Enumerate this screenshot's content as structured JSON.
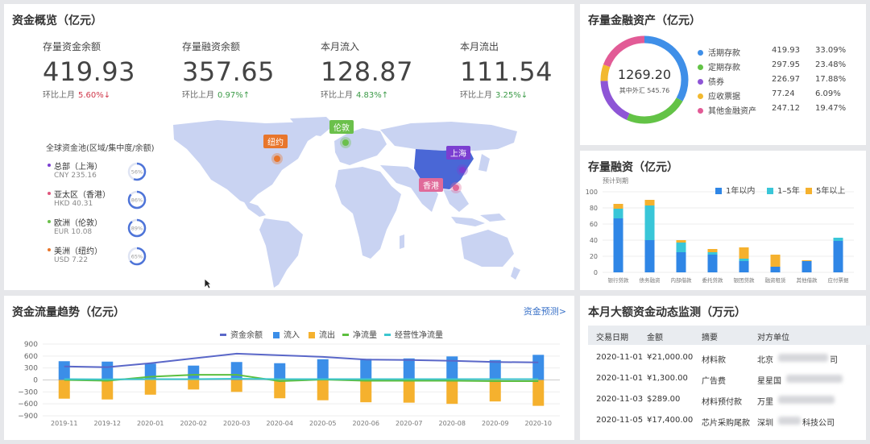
{
  "overview": {
    "title": "资金概览（亿元）",
    "kpis": [
      {
        "label": "存量资金余额",
        "value": "419.93",
        "compare": "环比上月",
        "pct": "5.60%",
        "arrow": "↓",
        "trend": "down"
      },
      {
        "label": "存量融资余额",
        "value": "357.65",
        "compare": "环比上月",
        "pct": "0.97%",
        "arrow": "↑",
        "trend": "up"
      },
      {
        "label": "本月流入",
        "value": "128.87",
        "compare": "环比上月",
        "pct": "4.83%",
        "arrow": "↑",
        "trend": "up"
      },
      {
        "label": "本月流出",
        "value": "111.54",
        "compare": "环比上月",
        "pct": "3.25%",
        "arrow": "↓",
        "trend": "down"
      }
    ],
    "pool_title": "全球资金池(区域/集中度/余额)",
    "pool": [
      {
        "name": "总部（上海）",
        "amount": "CNY 235.16",
        "pct": "56%",
        "color": "#7b3fd1"
      },
      {
        "name": "亚太区（香港）",
        "amount": "HKD 40.31",
        "pct": "86%",
        "color": "#e0557c"
      },
      {
        "name": "欧洲（伦敦）",
        "amount": "EUR 10.08",
        "pct": "89%",
        "color": "#6bc04b"
      },
      {
        "name": "美洲（纽约）",
        "amount": "USD 7.22",
        "pct": "65%",
        "color": "#e8762c"
      }
    ],
    "map_pins": [
      {
        "label": "纽约",
        "color": "#e8762c"
      },
      {
        "label": "伦敦",
        "color": "#6bc04b"
      },
      {
        "label": "上海",
        "color": "#7b3fd1"
      },
      {
        "label": "香港",
        "color": "#e06a9a"
      }
    ]
  },
  "assets": {
    "title": "存量金融资产（亿元）",
    "total": "1269.20",
    "sub": "其中外汇 545.76",
    "items": [
      {
        "name": "活期存款",
        "value": "419.93",
        "pct": "33.09%",
        "color": "#3f8fe8",
        "share": 33.09
      },
      {
        "name": "定期存款",
        "value": "297.95",
        "pct": "23.48%",
        "color": "#63c346",
        "share": 23.48
      },
      {
        "name": "债券",
        "value": "226.97",
        "pct": "17.88%",
        "color": "#8e55d6",
        "share": 17.88
      },
      {
        "name": "应收票据",
        "value": "77.24",
        "pct": "6.09%",
        "color": "#f2b92f",
        "share": 6.09
      },
      {
        "name": "其他金融资产",
        "value": "247.12",
        "pct": "19.47%",
        "color": "#e25b96",
        "share": 19.47
      }
    ]
  },
  "financing": {
    "title": "存量融资（亿元）",
    "chart_data": {
      "type": "bar",
      "stacked": true,
      "subtitle": "预计到期",
      "categories": [
        "银行贷款",
        "债务融资",
        "内部借款",
        "委托贷款",
        "银团贷款",
        "融资租赁",
        "其他借款",
        "应付票据"
      ],
      "ylim": [
        0,
        100
      ],
      "yticks": [
        "0",
        "20",
        "40",
        "60",
        "80",
        "100"
      ],
      "legend_position": "top-right",
      "series": [
        {
          "name": "1年以内",
          "color": "#2f86e6",
          "values": [
            67,
            40,
            25,
            22,
            14,
            7,
            14,
            39
          ]
        },
        {
          "name": "1–5年",
          "color": "#39c6d8",
          "values": [
            12,
            43,
            12,
            3,
            3,
            0,
            0,
            4
          ]
        },
        {
          "name": "5年以上",
          "color": "#f5b12e",
          "values": [
            6,
            7,
            3,
            4,
            14,
            15,
            1,
            0
          ]
        }
      ]
    }
  },
  "trend": {
    "title": "资金流量趋势（亿元）",
    "link": "资金预测>",
    "chart_data": {
      "type": "bar",
      "ylim": [
        -900,
        900
      ],
      "yticks": [
        "900",
        "600",
        "300",
        "0",
        "−300",
        "−600",
        "−900"
      ],
      "categories": [
        "2019-11",
        "2019-12",
        "2020-01",
        "2020-02",
        "2020-03",
        "2020-04",
        "2020-05",
        "2020-06",
        "2020-07",
        "2020-08",
        "2020-09",
        "2020-10"
      ],
      "legend_position": "top",
      "series": [
        {
          "name": "资金余额",
          "kind": "line",
          "color": "#5a67c8",
          "values": [
            340,
            320,
            420,
            540,
            660,
            620,
            580,
            510,
            500,
            480,
            450,
            440
          ]
        },
        {
          "name": "流入",
          "kind": "bar",
          "color": "#3b8ee8",
          "values": [
            470,
            460,
            410,
            360,
            450,
            420,
            520,
            530,
            540,
            590,
            500,
            630
          ]
        },
        {
          "name": "流出",
          "kind": "bar",
          "color": "#f5b12e",
          "values": [
            -470,
            -490,
            -370,
            -240,
            -300,
            -460,
            -510,
            -560,
            -570,
            -600,
            -540,
            -650
          ]
        },
        {
          "name": "净流量",
          "kind": "line",
          "color": "#5cbf3f",
          "values": [
            0,
            -20,
            80,
            130,
            130,
            -30,
            10,
            -20,
            -20,
            -20,
            -30,
            -30
          ]
        },
        {
          "name": "经营性净流量",
          "kind": "line",
          "color": "#3cc6cf",
          "values": [
            20,
            15,
            20,
            20,
            30,
            20,
            20,
            20,
            20,
            20,
            20,
            20
          ]
        }
      ]
    }
  },
  "monitor": {
    "title": "本月大额资金动态监测（万元）",
    "headers": [
      "交易日期",
      "金额",
      "摘要",
      "对方单位"
    ],
    "rows": [
      {
        "date": "2020-11-01",
        "amount": "¥21,000.00",
        "memo": "材料款",
        "party_a": "北京",
        "party_b": "司"
      },
      {
        "date": "2020-11-01",
        "amount": "¥1,300.00",
        "memo": "广告费",
        "party_a": "星星国",
        "party_b": ""
      },
      {
        "date": "2020-11-03",
        "amount": "$289.00",
        "memo": "材料预付款",
        "party_a": "万里",
        "party_b": ""
      },
      {
        "date": "2020-11-05",
        "amount": "¥17,400.00",
        "memo": "芯片采购尾款",
        "party_a": "深圳",
        "party_b": "科技公司"
      }
    ]
  }
}
